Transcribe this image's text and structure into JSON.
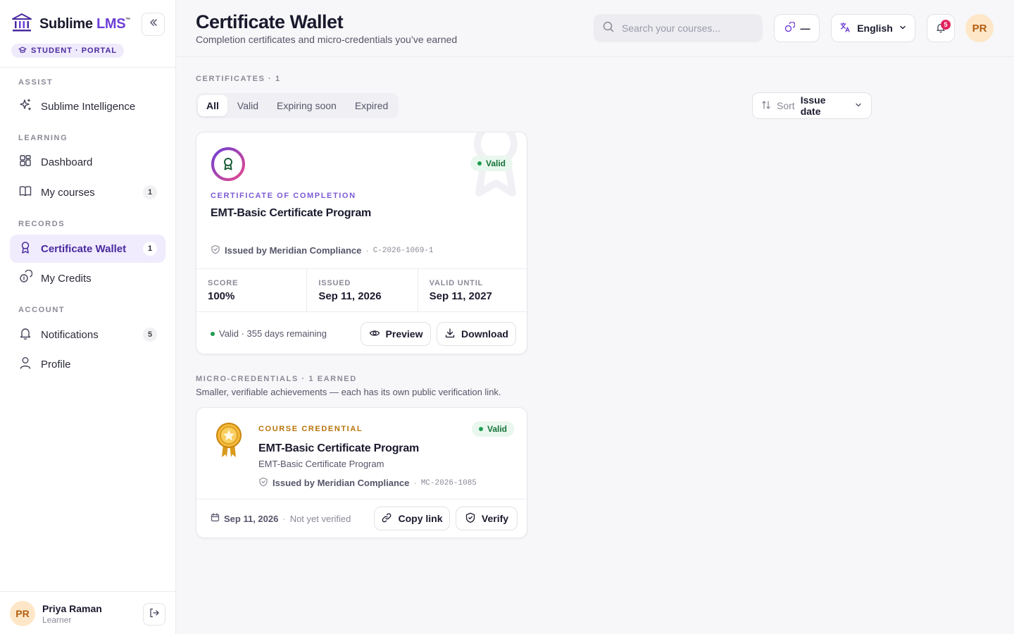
{
  "brand": {
    "name": "Sublime",
    "suffix": "LMS",
    "tm": "™",
    "portal": "STUDENT · PORTAL"
  },
  "sidebar": {
    "sections": {
      "assist": "ASSIST",
      "learning": "LEARNING",
      "records": "RECORDS",
      "account": "ACCOUNT"
    },
    "items": [
      {
        "label": "Sublime Intelligence",
        "icon": "sparkles-icon"
      },
      {
        "label": "Dashboard",
        "icon": "grid-icon"
      },
      {
        "label": "My courses",
        "icon": "book-icon",
        "count": "1"
      },
      {
        "label": "Certificate Wallet",
        "icon": "award-icon",
        "count": "1",
        "active": true
      },
      {
        "label": "My Credits",
        "icon": "coins-icon"
      },
      {
        "label": "Notifications",
        "icon": "bell-icon",
        "count": "5"
      },
      {
        "label": "Profile",
        "icon": "user-icon"
      }
    ],
    "user": {
      "initials": "PR",
      "name": "Priya Raman",
      "role": "Learner"
    }
  },
  "header": {
    "title": "Certificate Wallet",
    "subtitle": "Completion certificates and micro-credentials you’ve earned",
    "search_placeholder": "Search your courses...",
    "credits_value": "—",
    "language": "English",
    "notif_count": "5",
    "avatar_initials": "PR"
  },
  "certificates": {
    "label": "CERTIFICATES · 1",
    "tabs": [
      "All",
      "Valid",
      "Expiring soon",
      "Expired"
    ],
    "active_tab": "All",
    "sort_label": "Sort",
    "sort_value": "Issue date",
    "items": [
      {
        "kicker": "CERTIFICATE OF COMPLETION",
        "title": "EMT-Basic Certificate Program",
        "status": "Valid",
        "issuer_prefix": "Issued by",
        "issuer": "Meridian Compliance",
        "code": "C-2026-1069-1",
        "stats": [
          {
            "label": "Score",
            "value": "100%"
          },
          {
            "label": "Issued",
            "value": "Sep 11, 2026"
          },
          {
            "label": "Valid until",
            "value": "Sep 11, 2027"
          }
        ],
        "footer_note": "Valid · 355 days remaining",
        "preview_label": "Preview",
        "download_label": "Download"
      }
    ]
  },
  "micro_credentials": {
    "label": "MICRO-CREDENTIALS · 1 EARNED",
    "description": "Smaller, verifiable achievements — each has its own public verification link.",
    "items": [
      {
        "kicker": "COURSE CREDENTIAL",
        "title": "EMT-Basic Certificate Program",
        "subtitle": "EMT-Basic Certificate Program",
        "status": "Valid",
        "issuer_prefix": "Issued by",
        "issuer": "Meridian Compliance",
        "code": "MC-2026-1085",
        "date": "Sep 11, 2026",
        "verification": "Not yet verified",
        "copy_label": "Copy link",
        "verify_label": "Verify"
      }
    ]
  },
  "colors": {
    "accent": "#6d3fd6",
    "success": "#1e9e50",
    "gold": "#b8730a"
  }
}
